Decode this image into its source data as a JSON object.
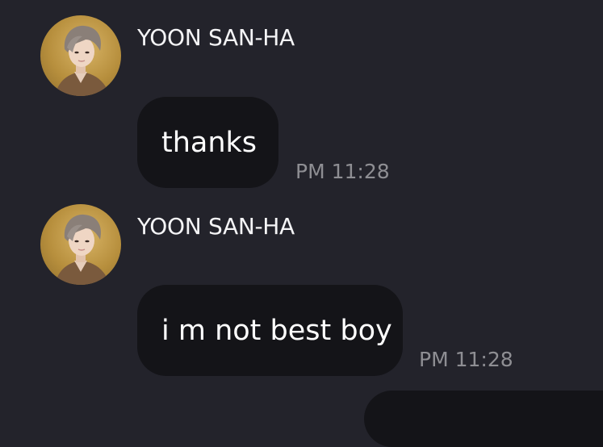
{
  "messages": [
    {
      "sender": "YOON SAN-HA",
      "text": "thanks",
      "time": "PM 11:28"
    },
    {
      "sender": "YOON SAN-HA",
      "text": "i m not best boy",
      "time": "PM 11:28"
    }
  ],
  "colors": {
    "background": "#23232b",
    "bubble": "#141418",
    "timestamp": "#8e8e93",
    "avatar_bg": "#c29b47"
  }
}
